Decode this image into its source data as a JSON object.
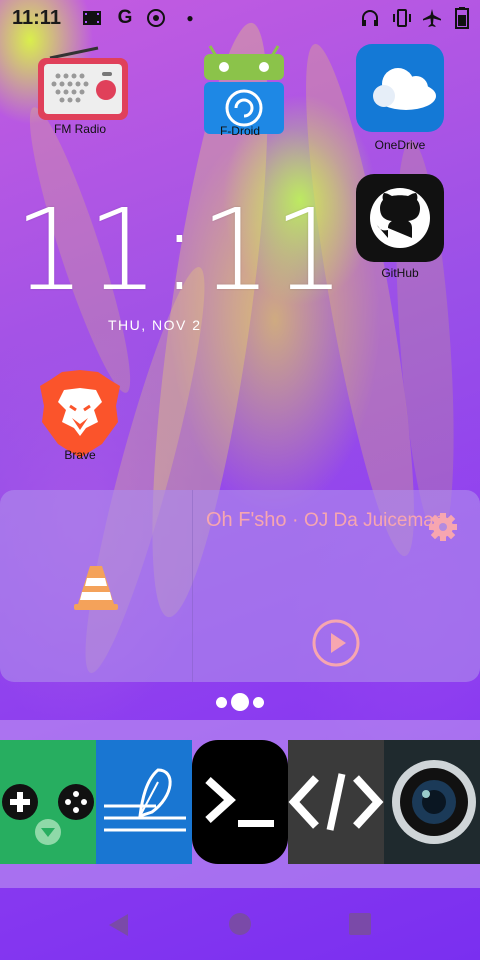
{
  "status_bar": {
    "time": "11:11",
    "left_icons": [
      "film-icon",
      "google-icon",
      "mail-icon",
      "dot-icon"
    ],
    "right_icons": [
      "headphones-icon",
      "vibrate-icon",
      "airplane-icon",
      "battery-icon"
    ]
  },
  "apps": [
    {
      "name": "fm-radio",
      "label": "FM Radio",
      "icon": "radio-icon"
    },
    {
      "name": "f-droid",
      "label": "F-Droid",
      "icon": "f-droid-icon"
    },
    {
      "name": "onedrive",
      "label": "OneDrive",
      "icon": "cloud-icon"
    },
    {
      "name": "github",
      "label": "GitHub",
      "icon": "github-icon"
    },
    {
      "name": "brave",
      "label": "Brave",
      "icon": "brave-lion-icon"
    }
  ],
  "clock": {
    "time": "11:11",
    "date": "THU, NOV 2"
  },
  "media_widget": {
    "song": "Oh F'sho",
    "separator": "·",
    "artist": "OJ Da Juiceman",
    "app_icon": "vlc-cone-icon",
    "play_icon": "play-icon",
    "settings_icon": "gear-icon"
  },
  "dock": [
    "gamepad-icon",
    "quill-icon",
    "terminal-icon",
    "code-icon",
    "camera-icon"
  ],
  "navigation": [
    "back-icon",
    "home-icon",
    "recents-icon"
  ],
  "colors": {
    "widget_text": "#f7a6b0",
    "accent_wallpaper": "#8c3cf0"
  }
}
